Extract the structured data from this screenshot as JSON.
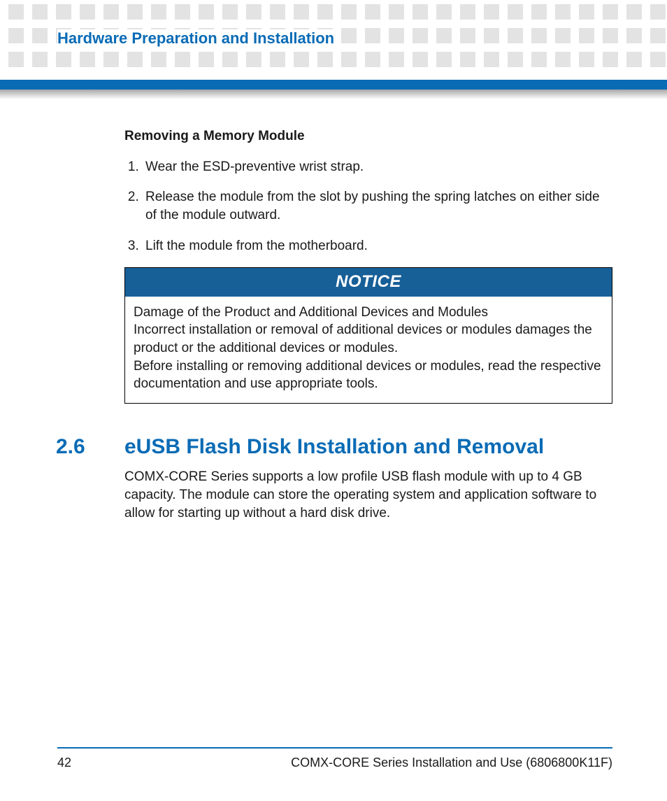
{
  "header": {
    "chapter_title": "Hardware Preparation and Installation"
  },
  "removing": {
    "heading": "Removing a Memory Module",
    "steps": [
      "Wear the ESD-preventive wrist strap.",
      "Release the module from the slot by pushing the spring latches on either side of the module outward.",
      "Lift the module from the motherboard."
    ]
  },
  "notice": {
    "label": "NOTICE",
    "line1": "Damage of the Product and Additional Devices and Modules",
    "line2": "Incorrect installation or removal of additional devices or modules damages the product or the additional devices or modules.",
    "line3": "Before installing or removing additional devices or modules, read the respective documentation and use appropriate tools."
  },
  "section": {
    "number": "2.6",
    "title": "eUSB Flash Disk Installation and Removal",
    "body": "COMX-CORE Series supports a low profile USB flash module with up to 4 GB capacity. The module can store the operating system and application software to allow for starting up without a hard disk drive."
  },
  "footer": {
    "page": "42",
    "doc": "COMX-CORE Series Installation and Use (6806800K11F)"
  }
}
